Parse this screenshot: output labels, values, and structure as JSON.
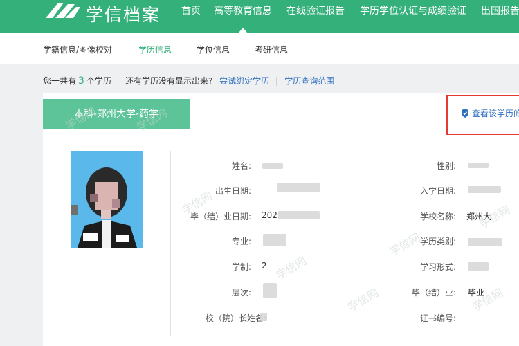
{
  "header": {
    "logo_text": "学信档案",
    "nav": [
      "首页",
      "高等教育信息",
      "在线验证报告",
      "学历学位认证与成绩验证",
      "出国报告"
    ],
    "active_nav": "高等教育信息"
  },
  "subnav": {
    "items": [
      "学籍信息/图像校对",
      "学历信息",
      "学位信息",
      "考研信息"
    ],
    "active": "学历信息"
  },
  "summary": {
    "prefix": "您一共有",
    "count": "3",
    "suffix": "个学历",
    "question": "还有学历没有显示出来?",
    "bind_link": "尝试绑定学历",
    "separator": "|",
    "scope_link": "学历查询范围"
  },
  "record": {
    "tab_title": "本科-郑州大学-药学",
    "verify_link": "查看该学历的",
    "fields": {
      "name_label": "姓名:",
      "gender_label": "性别:",
      "birth_label": "出生日期:",
      "enroll_label": "入学日期:",
      "grad_date_label": "毕（结）业日期:",
      "grad_date_value": "202",
      "school_label": "学校名称:",
      "school_value": "郑州大",
      "major_label": "专业:",
      "category_label": "学历类别:",
      "system_label": "学制:",
      "system_value": "2",
      "form_label": "学习形式:",
      "level_label": "层次:",
      "graduation_label": "毕（结）业:",
      "graduation_value": "毕业",
      "president_label": "校（院）长姓名:",
      "certificate_label": "证书编号:"
    }
  },
  "watermark_text": "学信网",
  "colors": {
    "brand_green": "#34b07b",
    "tab_green": "#5cc498",
    "link_blue": "#2f6fbf",
    "highlight_red": "#e53935"
  }
}
